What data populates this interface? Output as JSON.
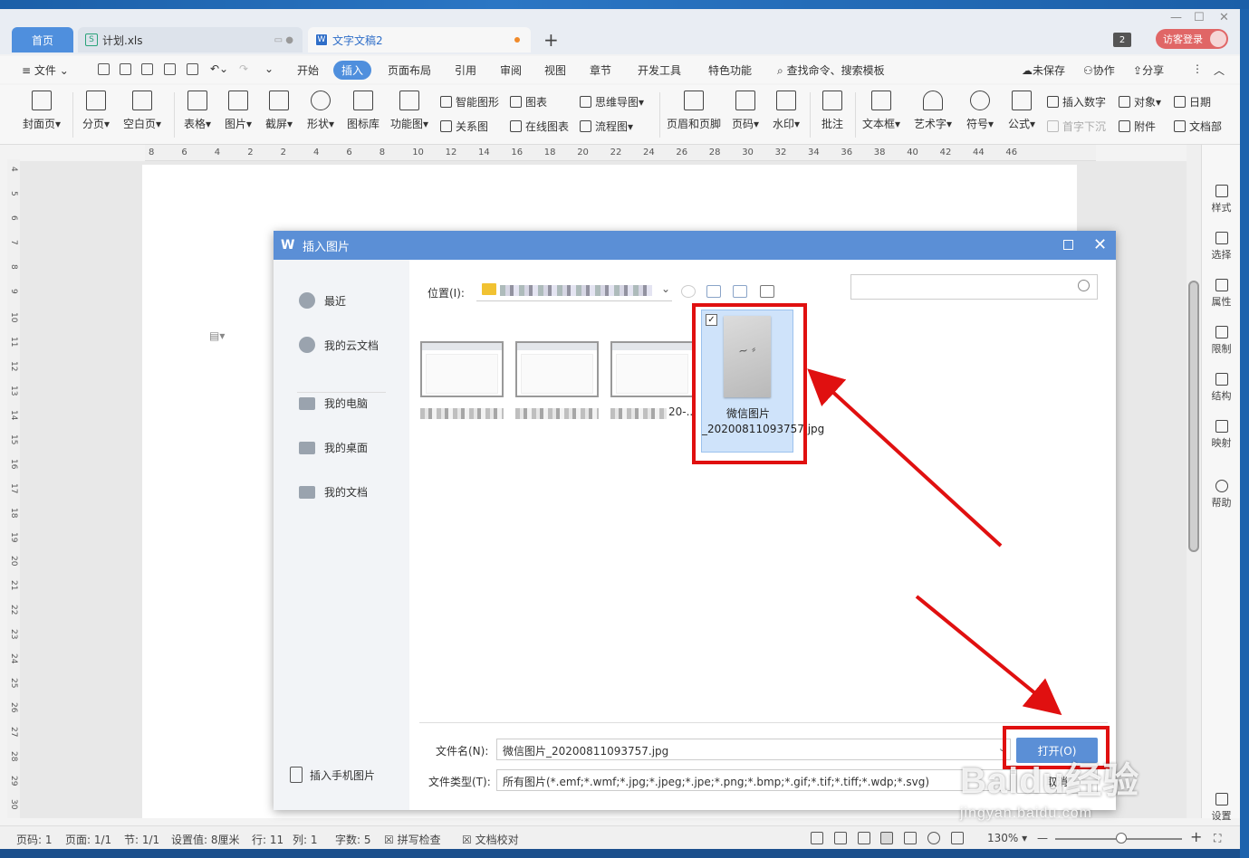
{
  "tabs": {
    "home": "首页",
    "xls": "计划.xls",
    "doc": "文字文稿2",
    "badge": "2",
    "login": "访客登录"
  },
  "menu": {
    "file": "文件",
    "items": [
      "开始",
      "插入",
      "页面布局",
      "引用",
      "审阅",
      "视图",
      "章节",
      "开发工具",
      "特色功能"
    ],
    "search": "查找命令、搜索模板",
    "unsaved": "未保存",
    "collab": "协作",
    "share": "分享"
  },
  "ribbon": {
    "big": [
      "封面页",
      "分页",
      "空白页",
      "表格",
      "图片",
      "截屏",
      "形状",
      "图标库",
      "功能图",
      "页眉和页脚",
      "页码",
      "水印",
      "批注",
      "文本框",
      "艺术字",
      "符号",
      "公式"
    ],
    "small_top": [
      "智能图形",
      "图表",
      "思维导图",
      "插入数字",
      "对象",
      "日期"
    ],
    "small_bottom": [
      "关系图",
      "在线图表",
      "流程图",
      "首字下沉",
      "附件",
      "文档部"
    ]
  },
  "ruler": {
    "h": [
      "8",
      "6",
      "4",
      "2",
      "2",
      "4",
      "6",
      "8",
      "10",
      "12",
      "14",
      "16",
      "18",
      "20",
      "22",
      "24",
      "26",
      "28",
      "30",
      "32",
      "34",
      "36",
      "38",
      "40",
      "42",
      "44",
      "46"
    ],
    "v": [
      "4",
      "5",
      "6",
      "7",
      "8",
      "9",
      "10",
      "11",
      "12",
      "13",
      "14",
      "15",
      "16",
      "17",
      "18",
      "19",
      "20",
      "21",
      "22",
      "23",
      "24",
      "25",
      "26",
      "27",
      "28",
      "29",
      "30"
    ]
  },
  "right_panel": [
    "样式",
    "选择",
    "属性",
    "限制",
    "结构",
    "映射",
    "帮助",
    "设置"
  ],
  "status": {
    "page_num": "页码: 1",
    "pages": "页面: 1/1",
    "section": "节: 1/1",
    "setting": "设置值: 8厘米",
    "row": "行: 11",
    "col": "列: 1",
    "words": "字数: 5",
    "spell": "拼写检查",
    "proof": "文档校对",
    "zoom": "130%"
  },
  "dialog": {
    "title": "插入图片",
    "nav": [
      "最近",
      "我的云文档",
      "我的电脑",
      "我的桌面",
      "我的文档"
    ],
    "phone": "插入手机图片",
    "location_label": "位置(I):",
    "selected_file": "微信图片_20200811093757.jpg",
    "thumb3_suffix": "20-..",
    "filename_label": "文件名(N):",
    "filename_value": "微信图片_20200811093757.jpg",
    "filetype_label": "文件类型(T):",
    "filetype_value": "所有图片(*.emf;*.wmf;*.jpg;*.jpeg;*.jpe;*.png;*.bmp;*.gif;*.tif;*.tiff;*.wdp;*.svg)",
    "open": "打开(O)",
    "cancel": "取消"
  },
  "watermark": {
    "main": "Baidu经验",
    "sub": "jingyan.baidu.com"
  },
  "colors": {
    "accent": "#5b8fd6",
    "annotation_red": "#e01010"
  }
}
